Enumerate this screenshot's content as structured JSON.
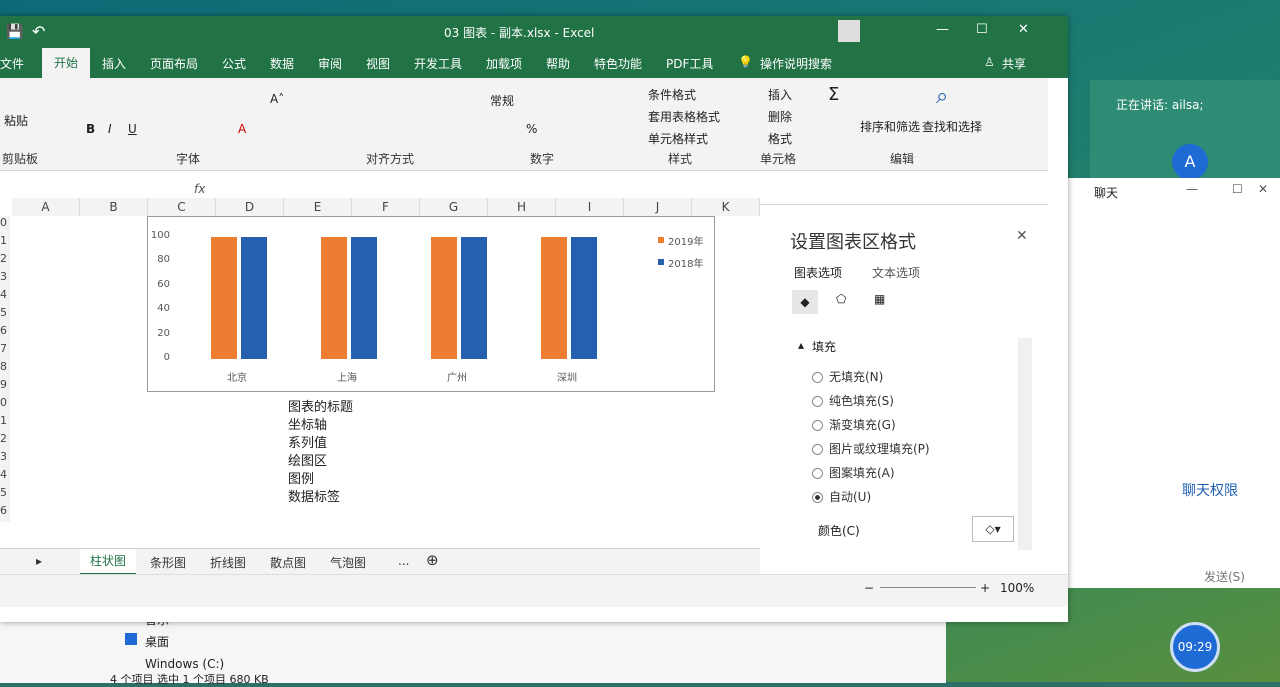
{
  "excel": {
    "title": "03 图表 - 副本.xlsx  -  Excel",
    "tabs": [
      "文件",
      "开始",
      "插入",
      "页面布局",
      "公式",
      "数据",
      "审阅",
      "视图",
      "开发工具",
      "加载项",
      "帮助",
      "特色功能",
      "PDF工具",
      "操作说明搜索"
    ],
    "share": "共享",
    "ribbon": {
      "groups": [
        "剪贴板",
        "字体",
        "对齐方式",
        "数字",
        "样式",
        "单元格",
        "编辑"
      ],
      "number_format": "常规",
      "styles": [
        "条件格式",
        "套用表格格式",
        "单元格样式"
      ],
      "cells": [
        "插入",
        "删除",
        "格式"
      ],
      "edit": [
        "排序和筛选",
        "查找和选择"
      ],
      "paste": "粘贴"
    },
    "formula_fx": "fx",
    "columns": [
      "A",
      "B",
      "C",
      "D",
      "E",
      "F",
      "G",
      "H",
      "I",
      "J",
      "K"
    ],
    "rows": [
      "0",
      "1",
      "2",
      "3",
      "4",
      "5",
      "6",
      "7",
      "8",
      "9",
      "0",
      "1",
      "2",
      "3",
      "4",
      "5",
      "6"
    ],
    "notes": [
      "图表的标题",
      "坐标轴",
      "系列值",
      "绘图区",
      "图例",
      "数据标签"
    ],
    "sheets": [
      "柱状图",
      "条形图",
      "折线图",
      "散点图",
      "气泡图",
      "..."
    ],
    "zoom": "100%"
  },
  "chart_data": {
    "type": "bar",
    "categories": [
      "北京",
      "上海",
      "广州",
      "深圳"
    ],
    "series": [
      {
        "name": "2019年",
        "values": [
          100,
          100,
          100,
          100
        ],
        "color": "#ed7d31"
      },
      {
        "name": "2018年",
        "values": [
          100,
          100,
          100,
          100
        ],
        "color": "#255fad"
      }
    ],
    "yticks": [
      "100",
      "80",
      "60",
      "40",
      "20",
      "0"
    ],
    "ylim": [
      0,
      100
    ]
  },
  "pane": {
    "title": "设置图表区格式",
    "tab1": "图表选项",
    "tab2": "文本选项",
    "section": "填充",
    "options": [
      "无填充(N)",
      "纯色填充(S)",
      "渐变填充(G)",
      "图片或纹理填充(P)",
      "图案填充(A)",
      "自动(U)"
    ],
    "color_label": "颜色(C)"
  },
  "chat": {
    "speaking": "正在讲话: ailsa;",
    "avatar": "A",
    "title": "聊天",
    "perm": "聊天权限",
    "send": "发送(S)",
    "time": "09:29"
  },
  "explorer": {
    "items": [
      "音乐",
      "桌面",
      "Windows (C:)"
    ],
    "status": "4 个项目    选中 1 个项目  680 KB"
  }
}
